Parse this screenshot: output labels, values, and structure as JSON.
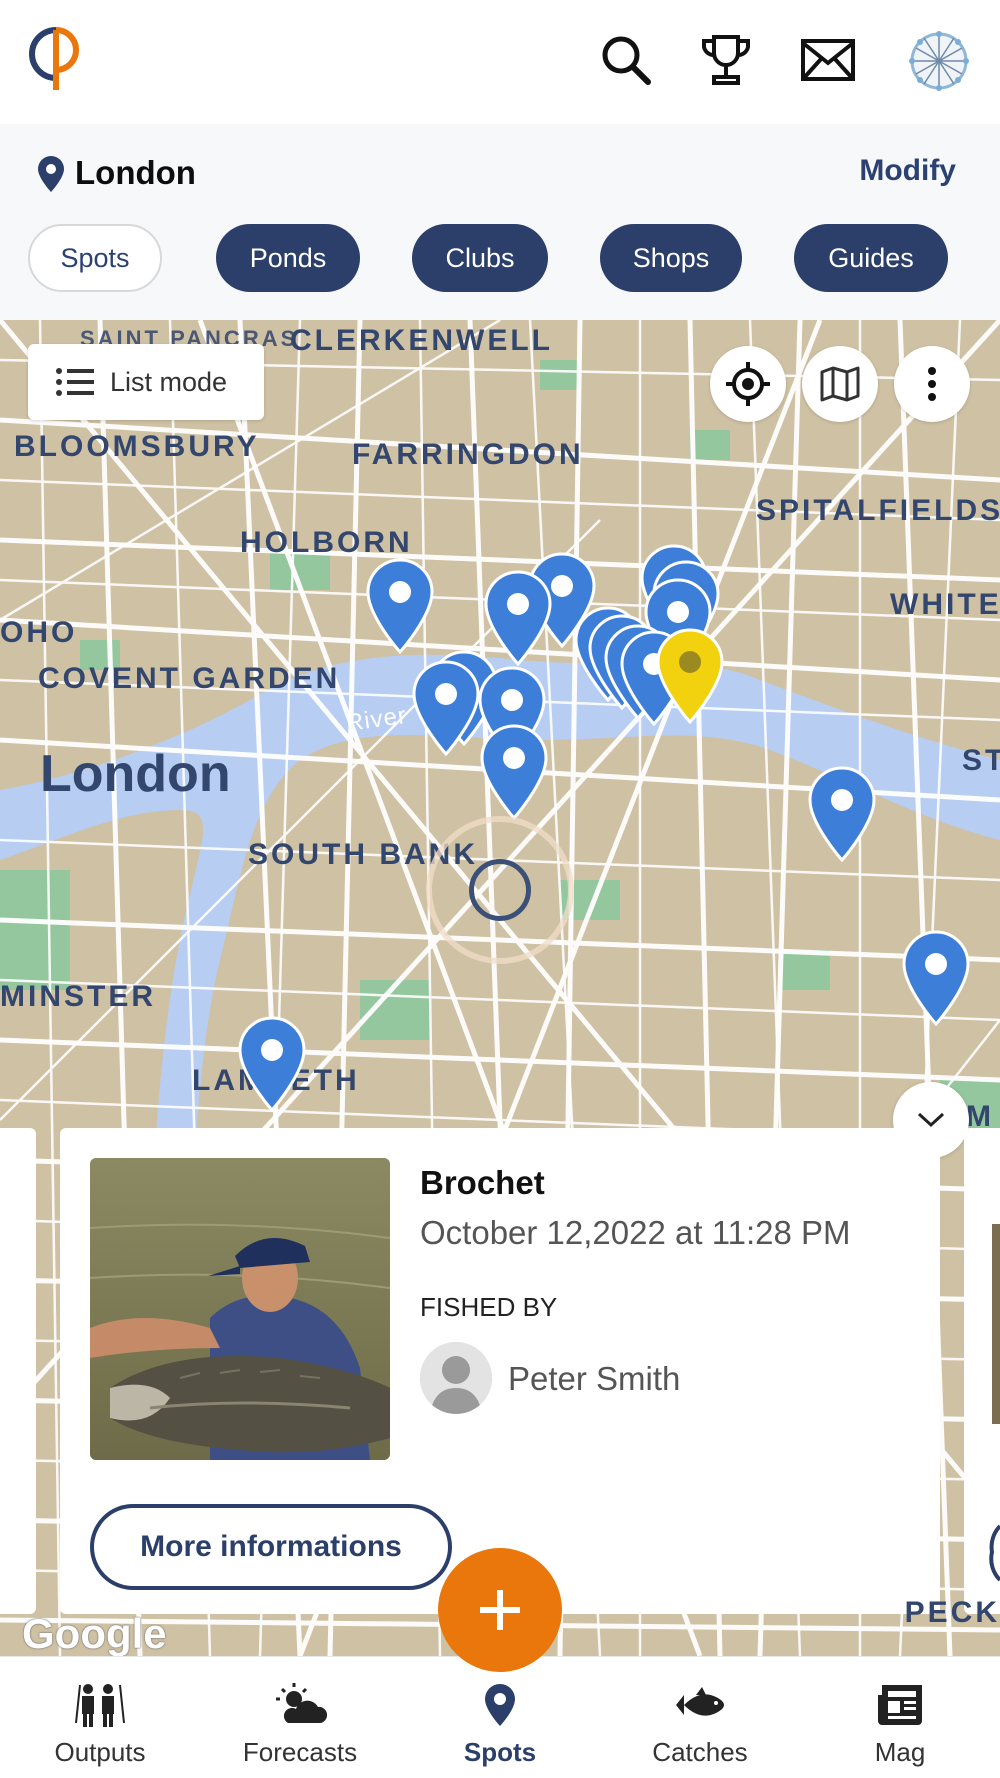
{
  "header": {
    "icons": [
      "logo",
      "search-icon",
      "trophy-icon",
      "mail-icon",
      "avatar"
    ]
  },
  "location": {
    "name": "London",
    "modify_label": "Modify"
  },
  "filters": [
    {
      "label": "Spots",
      "active": true
    },
    {
      "label": "Ponds",
      "active": false
    },
    {
      "label": "Clubs",
      "active": false
    },
    {
      "label": "Shops",
      "active": false
    },
    {
      "label": "Guides",
      "active": false
    }
  ],
  "map": {
    "list_mode_label": "List mode",
    "labels": {
      "saint_pancras": "SAINT PANCRAS",
      "clerkenwell": "CLERKENWELL",
      "bloomsbury": "BLOOMSBURY",
      "farringdon": "FARRINGDON",
      "spitalfields": "SPITALFIELDS",
      "holborn": "HOLBORN",
      "soho": "OHO",
      "whitechapel": "WHITE",
      "covent_garden": "COVENT GARDEN",
      "river": "River",
      "london": "London",
      "st": "ST",
      "south_bank": "SOUTH BANK",
      "westminster": "MINSTER",
      "lambeth": "LAMBETH",
      "m": "M",
      "peckham": "PECK"
    },
    "attribution": "Google",
    "colors": {
      "land": "#cfc1a3",
      "water": "#b7cdf2",
      "road": "#ffffff",
      "park": "#95c79e",
      "marker": "#3d7fd8",
      "marker_selected": "#f2d10f"
    }
  },
  "card": {
    "title": "Brochet",
    "date": "October 12,2022 at 11:28 PM",
    "fished_by_label": "FISHED BY",
    "fisher_name": "Peter Smith",
    "more_label": "More informations"
  },
  "bottom_nav": [
    {
      "label": "Outputs",
      "icon": "outputs-icon",
      "active": false
    },
    {
      "label": "Forecasts",
      "icon": "forecasts-icon",
      "active": false
    },
    {
      "label": "Spots",
      "icon": "spots-icon",
      "active": true
    },
    {
      "label": "Catches",
      "icon": "catches-icon",
      "active": false
    },
    {
      "label": "Mag",
      "icon": "mag-icon",
      "active": false
    }
  ],
  "accent": {
    "primary": "#2b3f6a",
    "fab": "#e9770c"
  }
}
